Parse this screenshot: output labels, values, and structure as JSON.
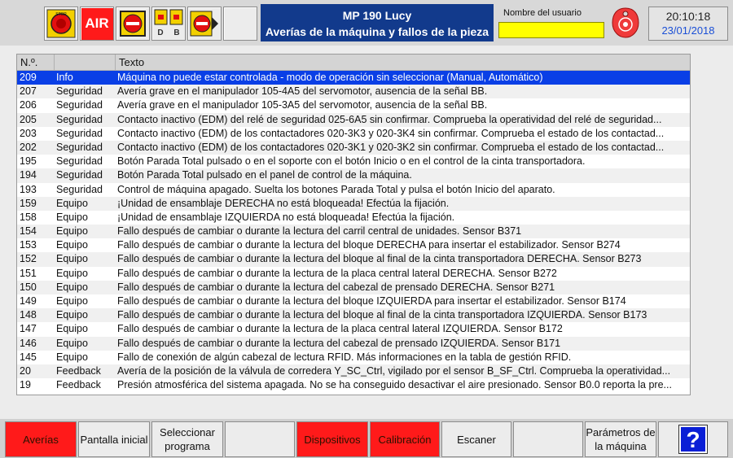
{
  "header": {
    "buttons": [
      {
        "name": "emergency-stop-icon",
        "label": "STOP"
      },
      {
        "name": "air-button",
        "label": "AIR"
      },
      {
        "name": "stop-door-icon",
        "label": ""
      },
      {
        "name": "door-d-b-icon",
        "label_d": "D",
        "label_b": "B"
      },
      {
        "name": "stop-arrow-icon",
        "label": ""
      }
    ],
    "title_line1": "MP 190 Lucy",
    "title_line2": "Averías de la máquina y fallos de la pieza",
    "user_label": "Nombre del usuario",
    "user_value": "",
    "time": "20:10:18",
    "date": "23/01/2018"
  },
  "table": {
    "headers": [
      "N.º.",
      "",
      "Texto"
    ],
    "rows": [
      {
        "num": "209",
        "type": "Info",
        "text": "Máquina no puede estar controlada - modo de operación sin seleccionar (Manual, Automático)",
        "selected": true
      },
      {
        "num": "207",
        "type": "Seguridad",
        "text": "Avería grave en el manipulador 105-4A5 del servomotor, ausencia de la señal BB."
      },
      {
        "num": "206",
        "type": "Seguridad",
        "text": "Avería grave en el manipulador 105-3A5 del servomotor, ausencia de la señal BB."
      },
      {
        "num": "205",
        "type": "Seguridad",
        "text": "Contacto inactivo (EDM) del relé de seguridad 025-6A5 sin confirmar. Comprueba la operatividad del relé de seguridad..."
      },
      {
        "num": "203",
        "type": "Seguridad",
        "text": "Contacto inactivo (EDM) de los contactadores 020-3K3 y 020-3K4 sin confirmar. Comprueba el estado de los contactad..."
      },
      {
        "num": "202",
        "type": "Seguridad",
        "text": "Contacto inactivo (EDM) de los contactadores 020-3K1 y 020-3K2 sin confirmar. Comprueba el estado de los contactad..."
      },
      {
        "num": "195",
        "type": "Seguridad",
        "text": "Botón Parada Total pulsado o en el soporte con el botón Inicio o en el control de la cinta transportadora."
      },
      {
        "num": "194",
        "type": "Seguridad",
        "text": "Botón Parada Total pulsado en el panel de control de la máquina."
      },
      {
        "num": "193",
        "type": "Seguridad",
        "text": "Control de máquina apagado. Suelta los botones Parada Total y pulsa el botón Inicio del aparato."
      },
      {
        "num": "159",
        "type": "Equipo",
        "text": "¡Unidad de ensamblaje DERECHA no está bloqueada! Efectúa la fijación."
      },
      {
        "num": "158",
        "type": "Equipo",
        "text": "¡Unidad de ensamblaje IZQUIERDA no está bloqueada! Efectúa la fijación."
      },
      {
        "num": "154",
        "type": "Equipo",
        "text": "Fallo después de cambiar o durante la lectura del carril central de unidades. Sensor B371"
      },
      {
        "num": "153",
        "type": "Equipo",
        "text": "Fallo después de cambiar o durante la lectura del bloque DERECHA para insertar el estabilizador. Sensor B274"
      },
      {
        "num": "152",
        "type": "Equipo",
        "text": "Fallo después de cambiar o durante la lectura del bloque al final de la cinta transportadora DERECHA. Sensor B273"
      },
      {
        "num": "151",
        "type": "Equipo",
        "text": "Fallo después de cambiar o durante la lectura de la placa central lateral DERECHA. Sensor B272"
      },
      {
        "num": "150",
        "type": "Equipo",
        "text": "Fallo después de cambiar o durante la lectura del cabezal de prensado DERECHA. Sensor B271"
      },
      {
        "num": "149",
        "type": "Equipo",
        "text": "Fallo después de cambiar o durante la lectura del bloque IZQUIERDA para insertar el estabilizador. Sensor B174"
      },
      {
        "num": "148",
        "type": "Equipo",
        "text": "Fallo después de cambiar o durante la lectura del bloque al final de la cinta transportadora IZQUIERDA. Sensor B173"
      },
      {
        "num": "147",
        "type": "Equipo",
        "text": "Fallo después de cambiar o durante la lectura de la placa central lateral IZQUIERDA. Sensor B172"
      },
      {
        "num": "146",
        "type": "Equipo",
        "text": "Fallo después de cambiar o durante la lectura del cabezal de prensado IZQUIERDA. Sensor B171"
      },
      {
        "num": "145",
        "type": "Equipo",
        "text": "Fallo de conexión de algún cabezal de lectura RFID. Más informaciones en la tabla de gestión RFID."
      },
      {
        "num": "20",
        "type": "Feedback",
        "text": "Avería de la posición de la válvula de corredera Y_SC_Ctrl, vigilado por el sensor B_SF_Ctrl. Comprueba la operatividad..."
      },
      {
        "num": "19",
        "type": "Feedback",
        "text": "Presión atmosférica del sistema apagada. No se ha conseguido desactivar el aire presionado. Sensor B0.0 reporta la pre..."
      }
    ]
  },
  "footer": {
    "buttons": [
      {
        "label": "Averías",
        "color": "red"
      },
      {
        "label": "Pantalla inicial",
        "color": "grey"
      },
      {
        "label": "Seleccionar programa",
        "color": "grey"
      },
      {
        "label": "",
        "color": "grey"
      },
      {
        "label": "Dispositivos",
        "color": "red"
      },
      {
        "label": "Calibración",
        "color": "red"
      },
      {
        "label": "Escaner",
        "color": "grey"
      },
      {
        "label": "",
        "color": "grey"
      },
      {
        "label": "Parámetros de la máquina",
        "color": "grey"
      },
      {
        "label": "?",
        "color": "blue"
      }
    ]
  },
  "colors": {
    "selected_row": "#0a3fe6",
    "title_bg": "#123a8c",
    "alarm_red": "#ff1a1a",
    "user_field": "#ffff00"
  }
}
